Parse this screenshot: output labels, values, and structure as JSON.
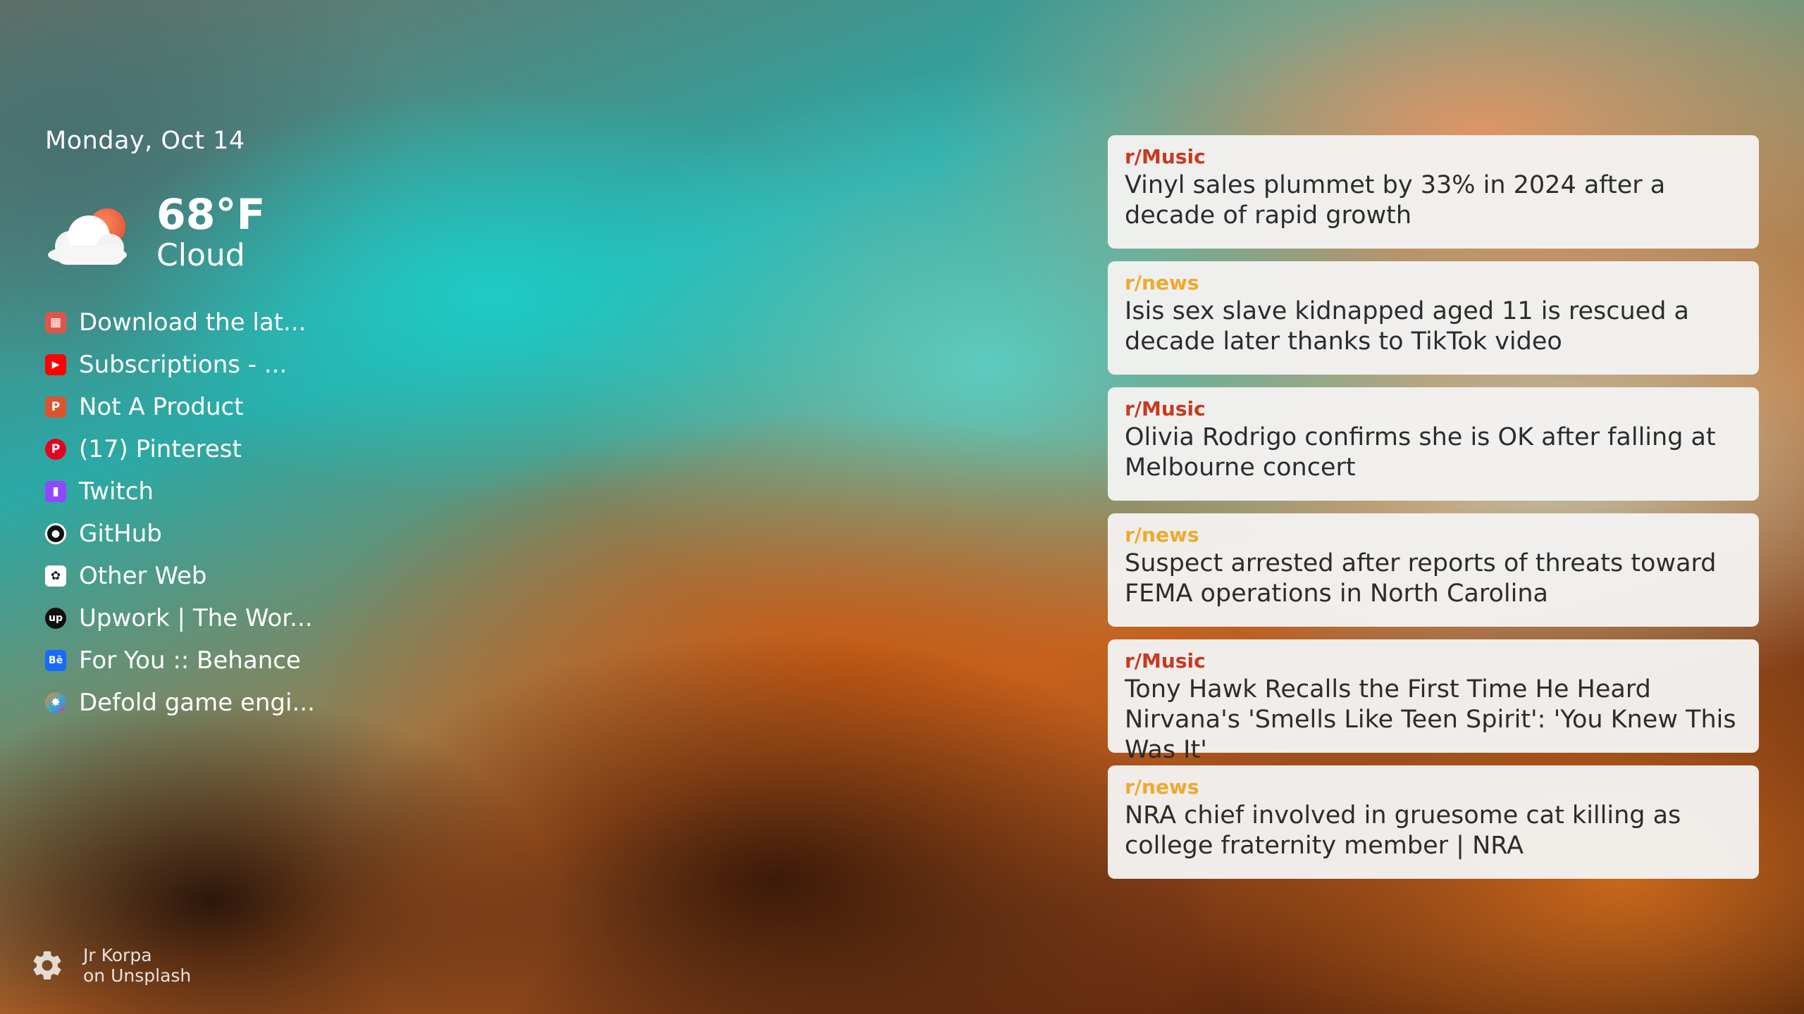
{
  "date": "Monday, Oct 14",
  "weather": {
    "temperature": "68°F",
    "condition": "Cloud",
    "icon": "cloud-sun-icon"
  },
  "bookmarks": [
    {
      "label": "Download the lat...",
      "icon": "download-page-icon",
      "color": "#e0554a",
      "glyph": "▦"
    },
    {
      "label": "Subscriptions - ...",
      "icon": "youtube-icon",
      "color": "#ff0000",
      "glyph": "▶"
    },
    {
      "label": "Not A Product",
      "icon": "product-hunt-icon",
      "color": "#da552f",
      "glyph": "P"
    },
    {
      "label": "(17) Pinterest",
      "icon": "pinterest-icon",
      "color": "#e60023",
      "glyph": "P"
    },
    {
      "label": "Twitch",
      "icon": "twitch-icon",
      "color": "#9146ff",
      "glyph": "▮"
    },
    {
      "label": "GitHub",
      "icon": "github-icon",
      "color": "#111111",
      "glyph": "●"
    },
    {
      "label": "Other Web",
      "icon": "openai-icon",
      "color": "#ffffff",
      "glyph": "✿"
    },
    {
      "label": "Upwork | The Wor...",
      "icon": "upwork-icon",
      "color": "#111111",
      "glyph": "up"
    },
    {
      "label": "For You :: Behance",
      "icon": "behance-icon",
      "color": "#1769ff",
      "glyph": "Bē"
    },
    {
      "label": "Defold game engi...",
      "icon": "defold-icon",
      "color": "#f08a24",
      "glyph": "✸"
    }
  ],
  "feed": [
    {
      "subreddit": "r/Music",
      "sub_color": "#c73a21",
      "title": "Vinyl sales plummet by 33% in 2024 after a decade of rapid growth"
    },
    {
      "subreddit": "r/news",
      "sub_color": "#f0a92c",
      "title": "Isis sex slave kidnapped aged 11 is rescued a decade later thanks to TikTok video"
    },
    {
      "subreddit": "r/Music",
      "sub_color": "#c73a21",
      "title": "Olivia Rodrigo confirms she is OK after falling at Melbourne concert"
    },
    {
      "subreddit": "r/news",
      "sub_color": "#f0a92c",
      "title": "Suspect arrested after reports of threats toward FEMA operations in North Carolina"
    },
    {
      "subreddit": "r/Music",
      "sub_color": "#c73a21",
      "title": "Tony Hawk Recalls the First Time He Heard Nirvana's 'Smells Like Teen Spirit': 'You Knew This Was It'"
    },
    {
      "subreddit": "r/news",
      "sub_color": "#f0a92c",
      "title": "NRA chief involved in gruesome cat killing as college fraternity member | NRA"
    }
  ],
  "footer": {
    "settings_icon": "gear-icon",
    "photographer": "Jr Korpa",
    "source": "on Unsplash"
  }
}
